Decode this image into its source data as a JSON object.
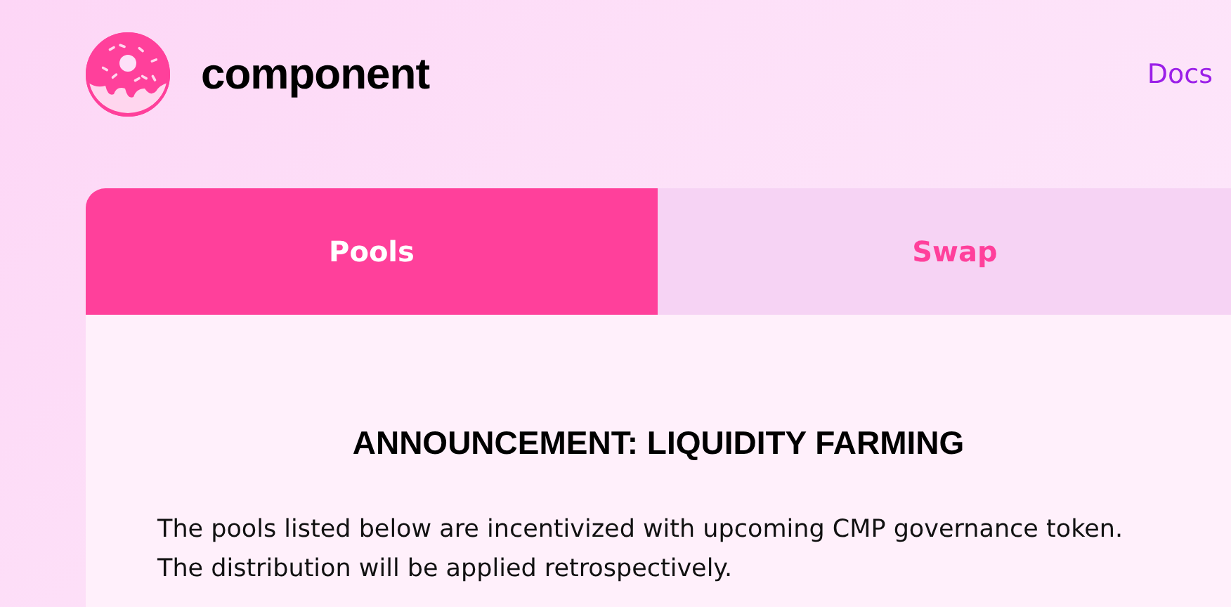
{
  "header": {
    "brand": "component",
    "nav_link": "Docs"
  },
  "tabs": [
    {
      "label": "Pools",
      "selected": true
    },
    {
      "label": "Swap",
      "selected": false
    }
  ],
  "announcement": {
    "title": "ANNOUNCEMENT: LIQUIDITY FARMING",
    "body": "The pools listed below are incentivized with upcoming CMP governance token. The distribution will be applied retrospectively."
  }
}
